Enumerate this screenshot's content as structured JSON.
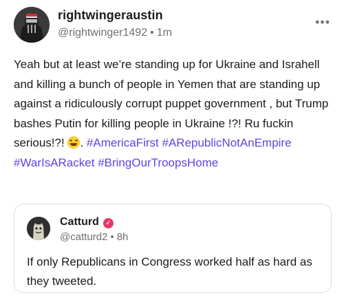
{
  "post": {
    "username": "rightwingeraustin",
    "handle": "@rightwinger1492",
    "time": "1m",
    "more_icon": "more-horizontal-icon",
    "text_before_emoji": "Yeah but at least we’re standing up for Ukraine and Israhell and killing a bunch of people in Yemen that are standing up against a ridiculously corrupt puppet government , but Trump bashes Putin for killing people in Ukraine !?! Ru fuckin serious!?!",
    "emoji": "laughing-tears-emoji",
    "text_after_emoji": ".",
    "hashtags": [
      "#AmericaFirst",
      "#ARepublicNotAnEmpire",
      "#WarIsARacket",
      "#BringOurTroopsHome"
    ]
  },
  "quote": {
    "username": "Catturd",
    "handle": "@catturd2",
    "time": "8h",
    "verified_icon": "verified-badge-icon",
    "text": "If only Republicans in Congress worked half as hard as they tweeted."
  },
  "colors": {
    "hashtag": "#5a45e6",
    "verified": "#e33a6b",
    "meta": "#6f6f6f"
  }
}
